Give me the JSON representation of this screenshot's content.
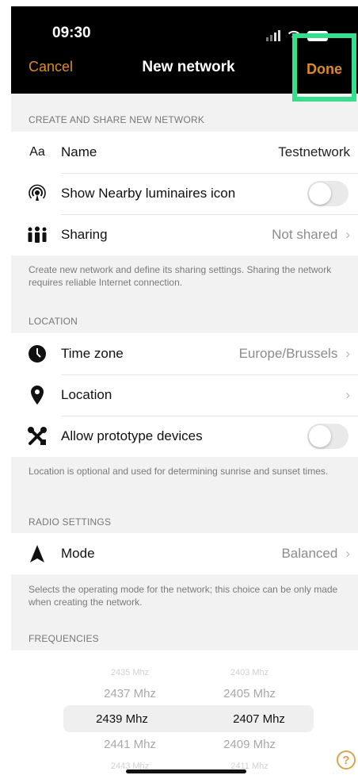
{
  "status_bar": {
    "time": "09:30"
  },
  "nav": {
    "cancel_label": "Cancel",
    "title": "New network",
    "done_label": "Done"
  },
  "sections": {
    "create": {
      "header": "CREATE AND SHARE NEW NETWORK",
      "rows": {
        "name": {
          "icon_text": "Aa",
          "label": "Name",
          "value": "Testnetwork"
        },
        "nearby": {
          "label": "Show Nearby luminaires icon",
          "toggle_on": false
        },
        "sharing": {
          "label": "Sharing",
          "value": "Not shared"
        }
      },
      "footnote": "Create new network and define its sharing settings. Sharing the network requires reliable Internet connection."
    },
    "location": {
      "header": "LOCATION",
      "rows": {
        "timezone": {
          "label": "Time zone",
          "value": "Europe/Brussels"
        },
        "location": {
          "label": "Location",
          "value": ""
        },
        "prototype": {
          "label": "Allow prototype devices",
          "toggle_on": false
        }
      },
      "footnote": "Location is optional and used for determining sunrise and sunset times."
    },
    "radio": {
      "header": "RADIO SETTINGS",
      "rows": {
        "mode": {
          "label": "Mode",
          "value": "Balanced"
        }
      },
      "footnote": "Selects the operating mode for the network; this choice can be only made when creating the network."
    },
    "frequencies": {
      "header": "FREQUENCIES",
      "left_column": [
        "2435 Mhz",
        "2437 Mhz",
        "2439 Mhz",
        "2441 Mhz",
        "2443 Mhz"
      ],
      "right_column": [
        "2403 Mhz",
        "2405 Mhz",
        "2407 Mhz",
        "2409 Mhz",
        "2411 Mhz"
      ],
      "selected_left": "2439 Mhz",
      "selected_right": "2407 Mhz"
    }
  },
  "icons": {
    "chevron": "chevron-right-icon",
    "help": "help-icon"
  },
  "colors": {
    "accent": "#e08a1e",
    "highlight": "#35e08d"
  }
}
